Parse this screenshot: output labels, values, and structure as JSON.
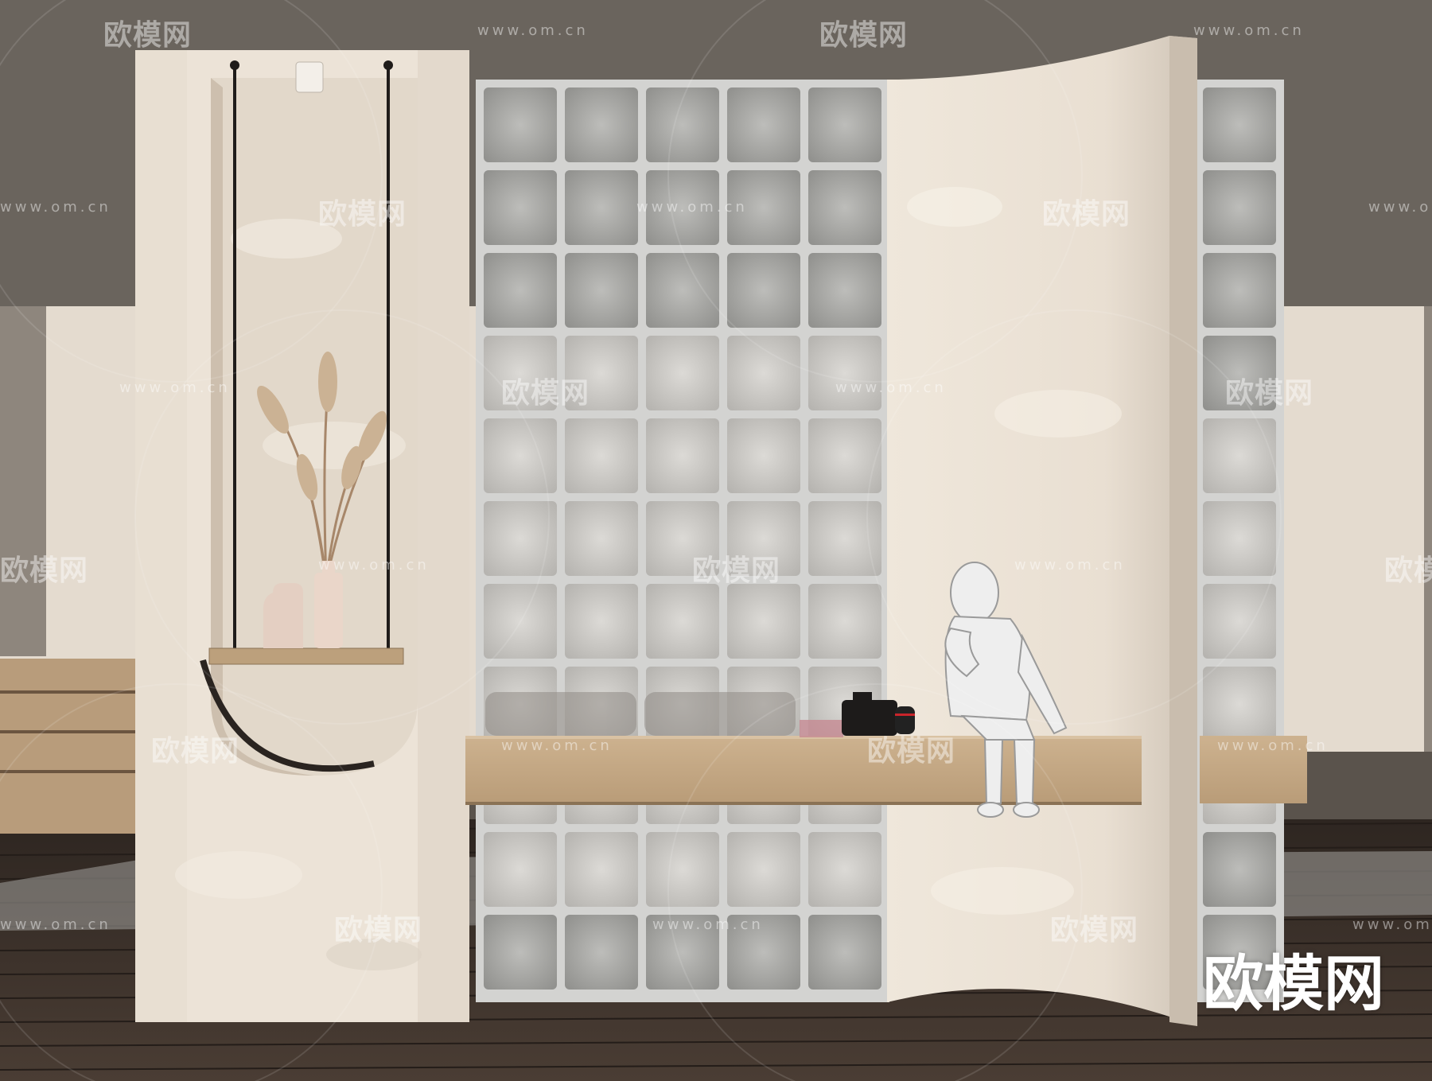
{
  "scene": {
    "watermark_brand": "欧模网",
    "watermark_url": "www.om.cn",
    "corner_brand": "欧模网",
    "colors": {
      "ceiling": "#6c665f",
      "back_wall": "#e6ddd0",
      "plaster_wall": "#efe6da",
      "glass_frame": "#c8c8c8",
      "glass_block": "#a9a9a6",
      "wood_bench": "#c8ad8b",
      "floor": "#3f342d",
      "vase": "#e6d2c4"
    },
    "objects": [
      "plaster-arch-wall",
      "hanging-shelf",
      "dried-pampas",
      "ceramic-vases",
      "glass-block-wall",
      "wood-bench",
      "camera",
      "seated-figure",
      "curved-plaster-wall",
      "wood-floor"
    ]
  }
}
